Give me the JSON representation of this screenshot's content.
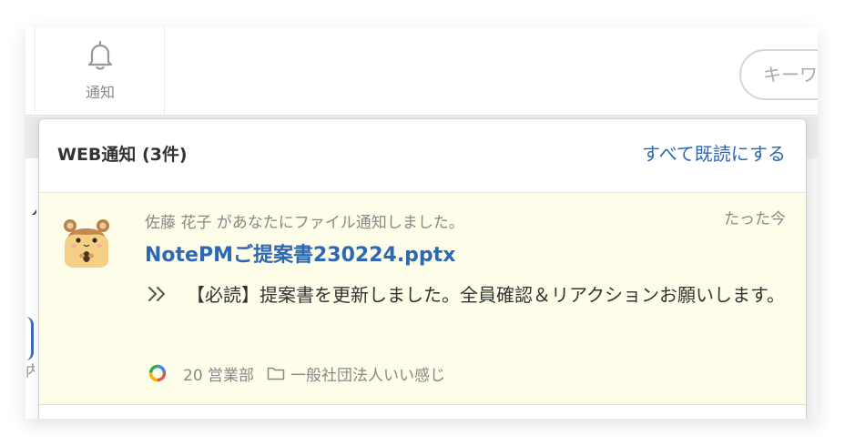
{
  "topbar": {
    "notification_label": "通知",
    "search_placeholder": "キーワ"
  },
  "background": {
    "frag_top": "ノ",
    "frag_bottom": "内"
  },
  "dropdown": {
    "title": "WEB通知 (3件)",
    "mark_all_read": "すべて既読にする"
  },
  "notification": {
    "sender_text": "佐藤 花子 があなたにファイル通知しました。",
    "time": "たった今",
    "file_name": "NotePMご提案書230224.pptx",
    "message": "【必読】提案書を更新しました。全員確認＆リアクションお願いします。",
    "department": "20 営業部",
    "workspace": "一般社団法人いい感じ"
  },
  "colors": {
    "link": "#2d68b4",
    "item_bg": "#fdfdea",
    "muted": "#888888"
  },
  "icons": [
    "bell-icon",
    "hamster-avatar",
    "double-chevron-icon",
    "department-ring-icon",
    "folder-icon"
  ]
}
